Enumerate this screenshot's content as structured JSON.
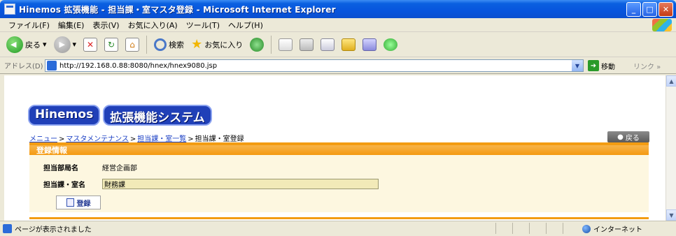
{
  "window": {
    "title": "Hinemos 拡張機能 - 担当課・室マスタ登録 - Microsoft Internet Explorer"
  },
  "menu": [
    "ファイル(F)",
    "編集(E)",
    "表示(V)",
    "お気に入り(A)",
    "ツール(T)",
    "ヘルプ(H)"
  ],
  "toolbar": {
    "back_label": "戻る",
    "search_label": "検索",
    "favorites_label": "お気に入り"
  },
  "address": {
    "label": "アドレス(D)",
    "url": "http://192.168.0.88:8080/hnex/hnex9080.jsp",
    "go_label": "移動",
    "links_label": "リンク »"
  },
  "page": {
    "logo_left": "Hinemos",
    "logo_right": "拡張機能システム",
    "breadcrumb": [
      {
        "label": "メニュー",
        "link": true
      },
      {
        "label": "マスタメンテナンス",
        "link": true
      },
      {
        "label": "担当課・室一覧",
        "link": true
      },
      {
        "label": "担当課・室登録",
        "link": false
      }
    ],
    "back_button": "戻る",
    "section_title": "登録情報",
    "fields": [
      {
        "label": "担当部局名",
        "value": "経営企画部"
      },
      {
        "label": "担当課・室名",
        "value": "財務課"
      }
    ],
    "register_button": "登録"
  },
  "status": {
    "text": "ページが表示されました",
    "zone": "インターネット"
  }
}
